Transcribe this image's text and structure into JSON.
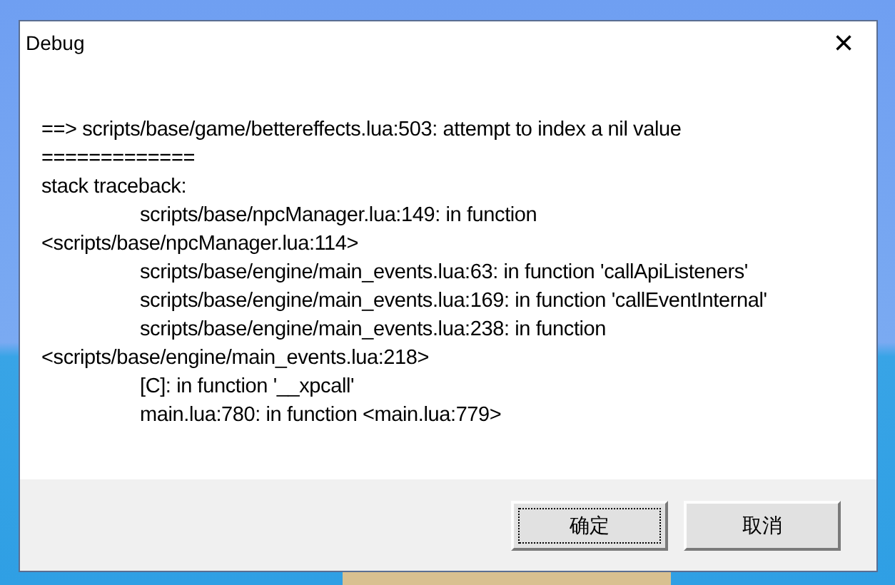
{
  "window": {
    "title": "Debug",
    "close": "×"
  },
  "message": [
    {
      "text": "==> scripts/base/game/bettereffects.lua:503: attempt to index a nil value",
      "indented": false
    },
    {
      "text": "=============",
      "indented": false
    },
    {
      "text": "stack traceback:",
      "indented": false
    },
    {
      "text": "scripts/base/npcManager.lua:149: in function",
      "indented": true
    },
    {
      "text": "<scripts/base/npcManager.lua:114>",
      "indented": false
    },
    {
      "text": "scripts/base/engine/main_events.lua:63: in function 'callApiListeners'",
      "indented": true
    },
    {
      "text": "scripts/base/engine/main_events.lua:169: in function 'callEventInternal'",
      "indented": true
    },
    {
      "text": "scripts/base/engine/main_events.lua:238: in function",
      "indented": true
    },
    {
      "text": "<scripts/base/engine/main_events.lua:218>",
      "indented": false
    },
    {
      "text": "[C]: in function '__xpcall'",
      "indented": true
    },
    {
      "text": "main.lua:780: in function <main.lua:779>",
      "indented": true
    }
  ],
  "buttons": [
    {
      "label": "确定",
      "focused": true
    },
    {
      "label": "取消",
      "focused": false
    }
  ]
}
